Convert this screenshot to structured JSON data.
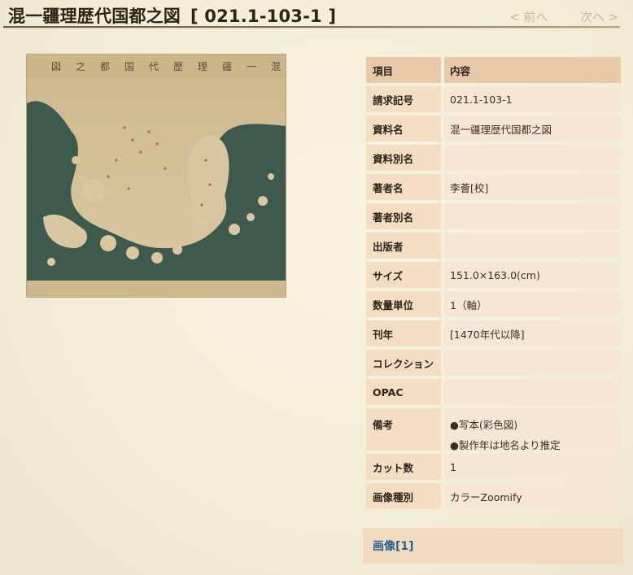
{
  "header": {
    "title": "混一疆理歴代国都之図",
    "code": "[ 021.1-103-1 ]",
    "prev_label": "< 前へ",
    "next_label": "次へ >"
  },
  "map": {
    "title_chars": [
      "混",
      "一",
      "疆",
      "理",
      "歴",
      "代",
      "国",
      "都",
      "之",
      "図"
    ]
  },
  "table": {
    "header": {
      "key": "項目",
      "value": "内容"
    },
    "rows": [
      {
        "key": "請求記号",
        "value": "021.1-103-1"
      },
      {
        "key": "資料名",
        "value": "混一疆理歴代国都之図"
      },
      {
        "key": "資料別名",
        "value": ""
      },
      {
        "key": "著者名",
        "value": "李薈[校]"
      },
      {
        "key": "著者別名",
        "value": ""
      },
      {
        "key": "出版者",
        "value": ""
      },
      {
        "key": "サイズ",
        "value": "151.0×163.0(cm)"
      },
      {
        "key": "数量単位",
        "value": "1（軸）"
      },
      {
        "key": "刊年",
        "value": "[1470年代以降]"
      },
      {
        "key": "コレクション",
        "value": ""
      },
      {
        "key": "OPAC",
        "value": ""
      },
      {
        "key": "備考",
        "value_lines": [
          "●写本(彩色図)",
          "●製作年は地名より推定"
        ]
      },
      {
        "key": "カット数",
        "value": "1"
      },
      {
        "key": "画像種別",
        "value": "カラーZoomify"
      }
    ]
  },
  "images": {
    "link_label": "画像[1]"
  },
  "colors": {
    "header_rule": "#6a5745",
    "label_bg": "#f3ddc3",
    "value_bg": "#f5e7d3",
    "head_bg": "#e7c8a7",
    "link": "#2a5f8c",
    "map_sea": "#3e5a4c",
    "map_land": "#d8c7a0"
  }
}
